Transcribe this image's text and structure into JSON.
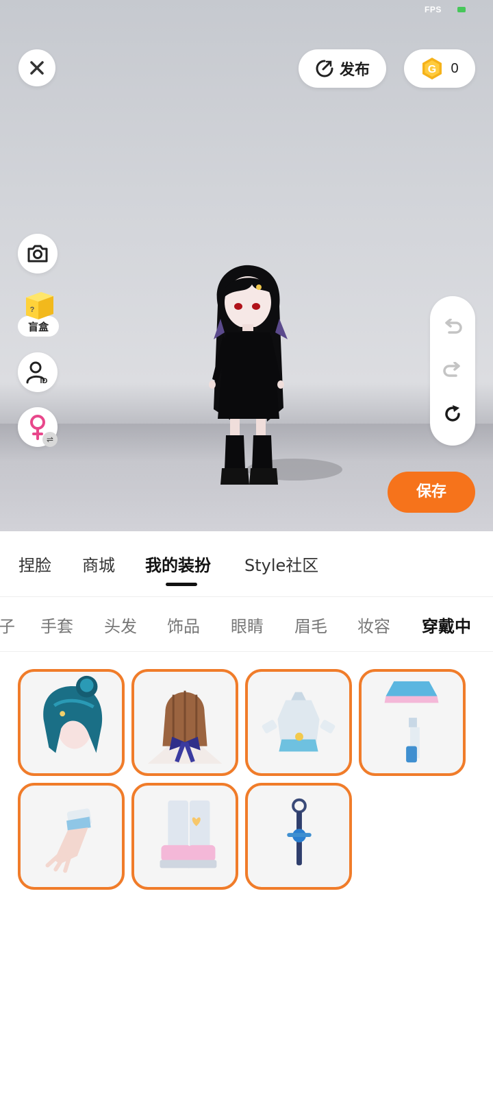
{
  "status": {
    "fps_label": "FPS"
  },
  "header": {
    "publish_label": "发布",
    "coin_count": "0",
    "coin_letter": "G"
  },
  "side_tools": {
    "blindbox_label": "盲盒",
    "blindbox_cube_mark": "?",
    "id_badge": "ID",
    "gender_swap_glyph": "⇌"
  },
  "save_label": "保存",
  "main_tabs": [
    {
      "label": "捏脸"
    },
    {
      "label": "商城"
    },
    {
      "label": "我的装扮",
      "active": true
    },
    {
      "label": "Style社区"
    }
  ],
  "sub_tabs": [
    {
      "label": "子"
    },
    {
      "label": "手套"
    },
    {
      "label": "头发"
    },
    {
      "label": "饰品"
    },
    {
      "label": "眼睛"
    },
    {
      "label": "眉毛"
    },
    {
      "label": "妆容"
    },
    {
      "label": "穿戴中",
      "active": true
    }
  ],
  "worn_items": [
    {
      "icon": "hair-bun-teal-icon"
    },
    {
      "icon": "hair-long-brown-bow-icon"
    },
    {
      "icon": "dress-light-blue-icon"
    },
    {
      "icon": "skirt-and-socks-icon"
    },
    {
      "icon": "glove-icon"
    },
    {
      "icon": "boots-pastel-icon"
    },
    {
      "icon": "wand-blue-icon"
    }
  ],
  "colors": {
    "accent_orange": "#f6731b",
    "item_border": "#f07c2a",
    "fps_indicator": "#47c75a",
    "coin_gold": "#f5b21a"
  }
}
